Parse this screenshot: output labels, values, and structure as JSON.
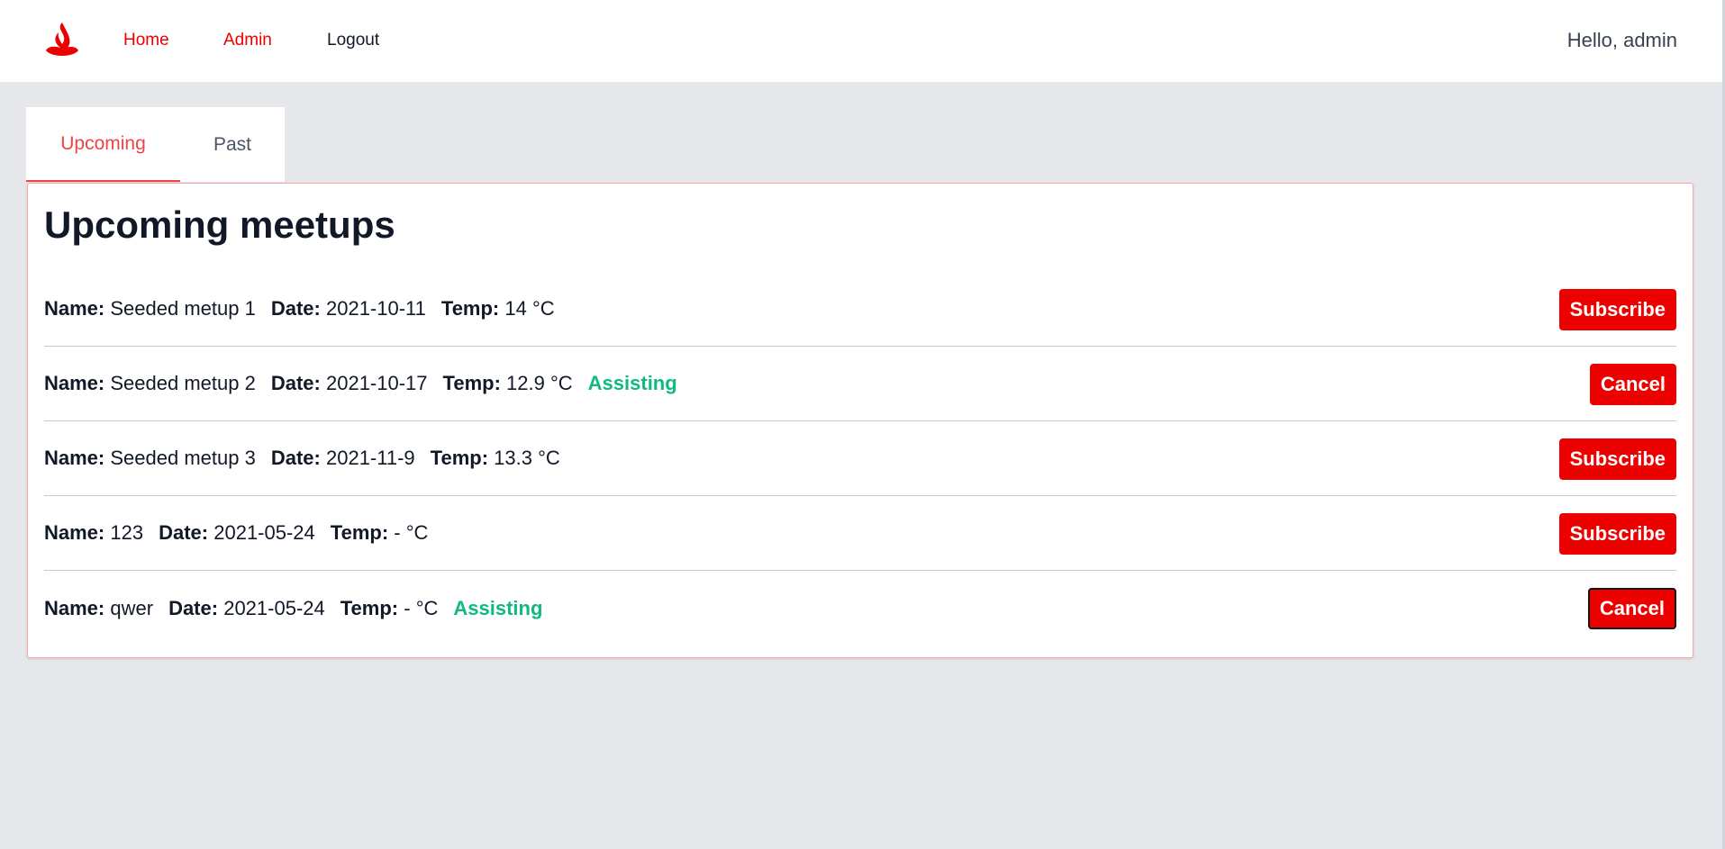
{
  "navbar": {
    "logo_icon": "flame-logo-icon",
    "links": [
      {
        "label": "Home"
      },
      {
        "label": "Admin"
      },
      {
        "label": "Logout"
      }
    ],
    "greeting": "Hello, admin"
  },
  "tabs": [
    {
      "label": "Upcoming",
      "active": true
    },
    {
      "label": "Past",
      "active": false
    }
  ],
  "panel": {
    "title": "Upcoming meetups",
    "labels": {
      "name": "Name:",
      "date": "Date:",
      "temp": "Temp:"
    },
    "meetups": [
      {
        "name": "Seeded metup 1",
        "date": "2021-10-11",
        "temp": "14 °C",
        "status": "",
        "action": "Subscribe"
      },
      {
        "name": "Seeded metup 2",
        "date": "2021-10-17",
        "temp": "12.9 °C",
        "status": "Assisting",
        "action": "Cancel"
      },
      {
        "name": "Seeded metup 3",
        "date": "2021-11-9",
        "temp": "13.3 °C",
        "status": "",
        "action": "Subscribe"
      },
      {
        "name": "123",
        "date": "2021-05-24",
        "temp": "- °C",
        "status": "",
        "action": "Subscribe"
      },
      {
        "name": "qwer",
        "date": "2021-05-24",
        "temp": "- °C",
        "status": "Assisting",
        "action": "Cancel"
      }
    ]
  },
  "colors": {
    "brand": "#ec0000",
    "status_assisting": "#10b981",
    "background": "#e5e7eb"
  }
}
